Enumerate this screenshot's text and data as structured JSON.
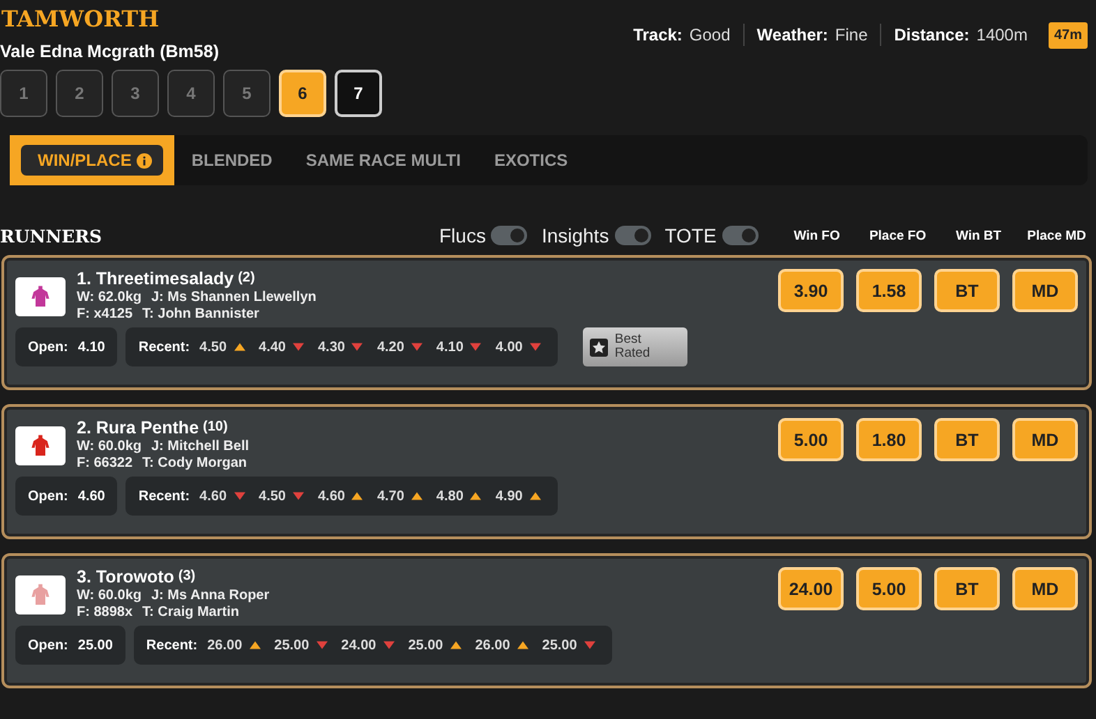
{
  "venue": "TAMWORTH",
  "race_name": "Vale Edna Mcgrath (Bm58)",
  "conditions": [
    {
      "label": "Track:",
      "value": "Good"
    },
    {
      "label": "Weather:",
      "value": "Fine"
    },
    {
      "label": "Distance:",
      "value": "1400m"
    }
  ],
  "countdown": "47m",
  "races": [
    {
      "label": "1",
      "selected": false,
      "disabled": true
    },
    {
      "label": "2",
      "selected": false,
      "disabled": true
    },
    {
      "label": "3",
      "selected": false,
      "disabled": true
    },
    {
      "label": "4",
      "selected": false,
      "disabled": true
    },
    {
      "label": "5",
      "selected": false,
      "disabled": true
    },
    {
      "label": "6",
      "selected": true,
      "disabled": false
    },
    {
      "label": "7",
      "selected": false,
      "disabled": false
    }
  ],
  "tabs": [
    {
      "label": "WIN/PLACE",
      "selected": true,
      "info": true
    },
    {
      "label": "BLENDED",
      "selected": false,
      "info": false
    },
    {
      "label": "SAME RACE MULTI",
      "selected": false,
      "info": false
    },
    {
      "label": "EXOTICS",
      "selected": false,
      "info": false
    }
  ],
  "runners_title": "RUNNERS",
  "toggles": [
    {
      "label": "Flucs",
      "on": true
    },
    {
      "label": "Insights",
      "on": true
    },
    {
      "label": "TOTE",
      "on": true
    }
  ],
  "columns": [
    "Win FO",
    "Place FO",
    "Win BT",
    "Place MD"
  ],
  "runners": [
    {
      "name": "1. Threetimesalady",
      "barrier": "(2)",
      "color": "#c2379a",
      "weight": "W: 62.0kg",
      "jockey": "J: Ms Shannen Llewellyn",
      "form": "F: x4125",
      "trainer": "T: John Bannister",
      "open_label": "Open:",
      "open": "4.10",
      "recent_label": "Recent:",
      "recent": [
        {
          "price": "4.50",
          "rising": true
        },
        {
          "price": "4.40",
          "rising": false
        },
        {
          "price": "4.30",
          "rising": false
        },
        {
          "price": "4.20",
          "rising": false
        },
        {
          "price": "4.10",
          "rising": false
        },
        {
          "price": "4.00",
          "rising": false
        }
      ],
      "badge": "Best Rated",
      "odds": [
        "3.90",
        "1.58",
        "BT",
        "MD"
      ]
    },
    {
      "name": "2. Rura Penthe",
      "barrier": "(10)",
      "color": "#d9251c",
      "weight": "W: 60.0kg",
      "jockey": "J: Mitchell Bell",
      "form": "F: 66322",
      "trainer": "T: Cody Morgan",
      "open_label": "Open:",
      "open": "4.60",
      "recent_label": "Recent:",
      "recent": [
        {
          "price": "4.60",
          "rising": false
        },
        {
          "price": "4.50",
          "rising": false
        },
        {
          "price": "4.60",
          "rising": true
        },
        {
          "price": "4.70",
          "rising": true
        },
        {
          "price": "4.80",
          "rising": true
        },
        {
          "price": "4.90",
          "rising": true
        }
      ],
      "odds": [
        "5.00",
        "1.80",
        "BT",
        "MD"
      ]
    },
    {
      "name": "3. Torowoto",
      "barrier": "(3)",
      "color": "#e8a0a0",
      "weight": "W: 60.0kg",
      "jockey": "J: Ms Anna Roper",
      "form": "F: 8898x",
      "trainer": "T: Craig Martin",
      "open_label": "Open:",
      "open": "25.00",
      "recent_label": "Recent:",
      "recent": [
        {
          "price": "26.00",
          "rising": true
        },
        {
          "price": "25.00",
          "rising": false
        },
        {
          "price": "24.00",
          "rising": false
        },
        {
          "price": "25.00",
          "rising": true
        },
        {
          "price": "26.00",
          "rising": true
        },
        {
          "price": "25.00",
          "rising": false
        }
      ],
      "odds": [
        "24.00",
        "5.00",
        "BT",
        "MD"
      ]
    }
  ]
}
